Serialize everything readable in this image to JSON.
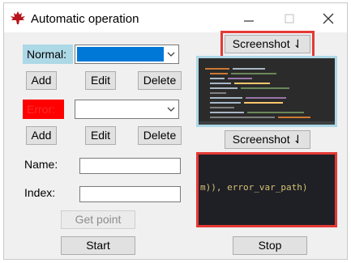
{
  "window": {
    "title": "Automatic operation",
    "icon": "maple-leaf-icon"
  },
  "normal": {
    "label": "Normal:",
    "selected_value": "",
    "add_label": "Add",
    "edit_label": "Edit",
    "delete_label": "Delete"
  },
  "error": {
    "label": "Error:",
    "selected_value": "",
    "add_label": "Add",
    "edit_label": "Edit",
    "delete_label": "Delete"
  },
  "form": {
    "name_label": "Name:",
    "name_value": "",
    "index_label": "Index:",
    "index_value": "",
    "get_point_label": "Get point"
  },
  "screenshots": {
    "button1_label": "Screenshot ⇃",
    "button2_label": "Screenshot ⇃",
    "preview2_code": "m)), error_var_path)"
  },
  "actions": {
    "start_label": "Start",
    "stop_label": "Stop"
  },
  "colors": {
    "normal_label_bg": "#add8e6",
    "error_label_bg": "#ff0000",
    "highlight": "#e53935",
    "selection": "#0078d7"
  }
}
